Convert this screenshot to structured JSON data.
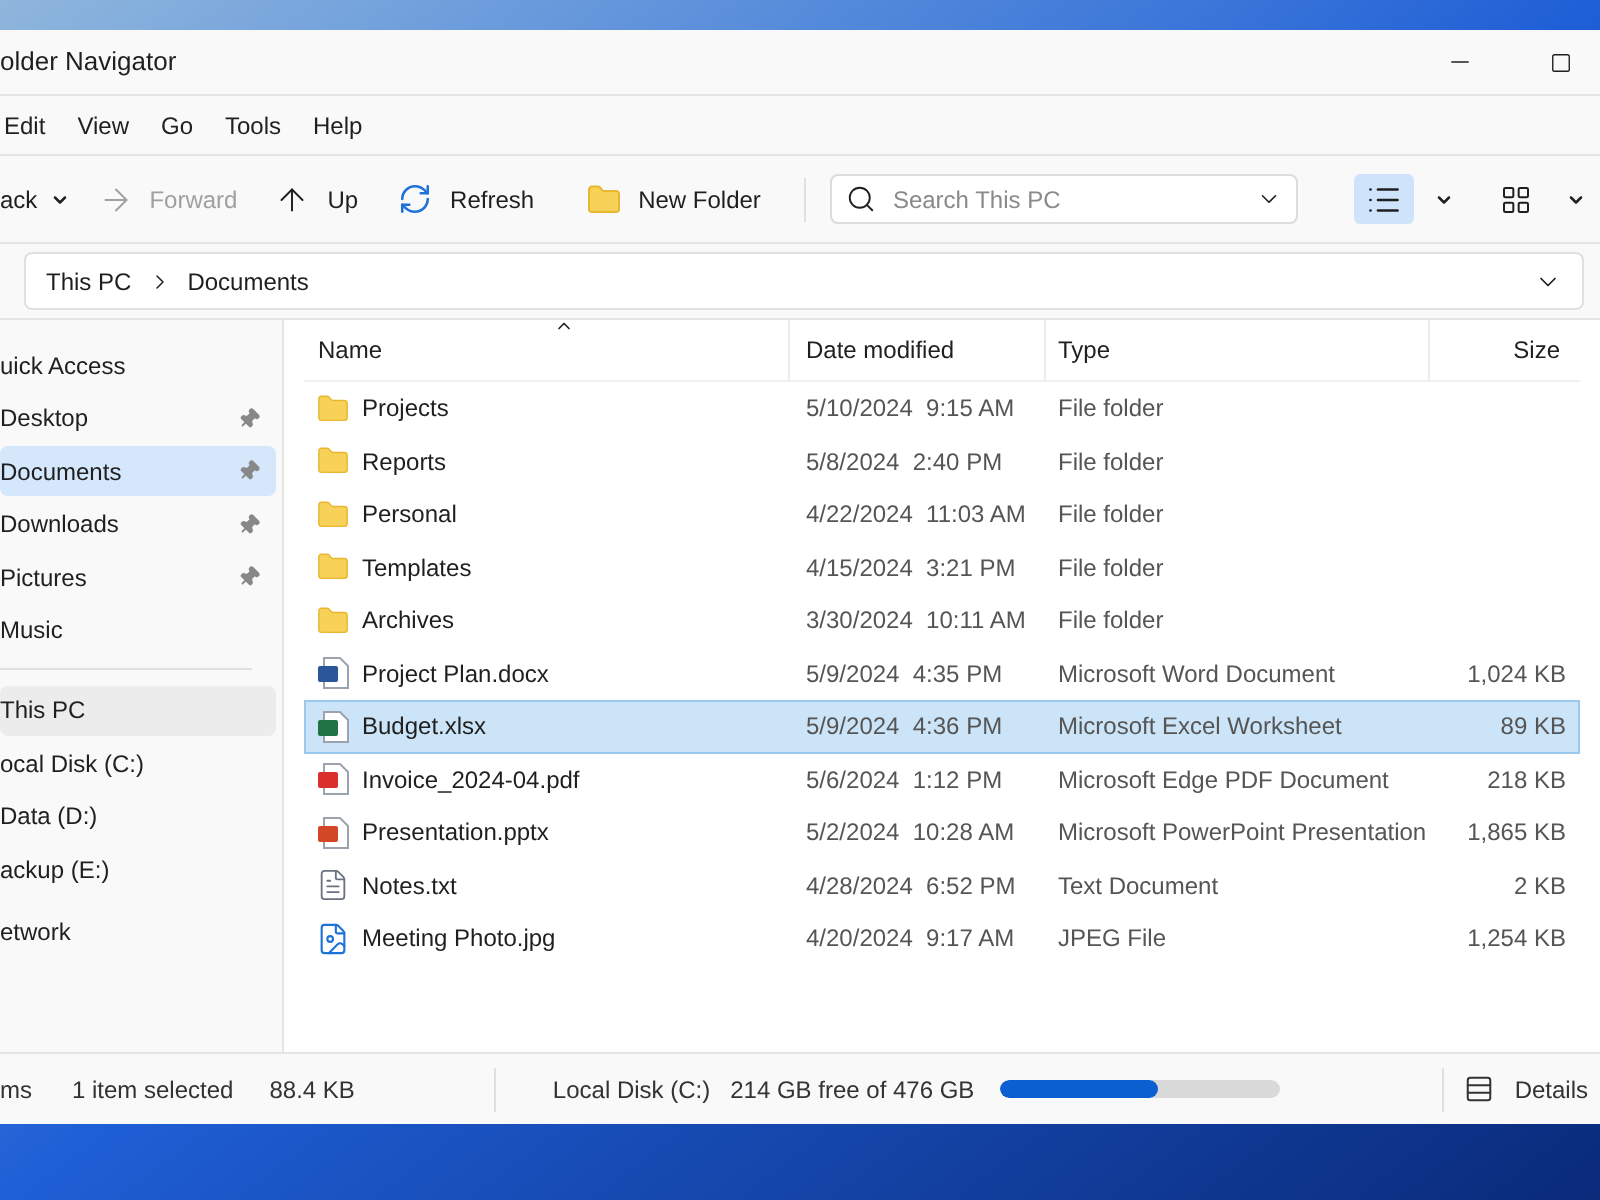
{
  "window": {
    "title": "older Navigator"
  },
  "menu": [
    "Edit",
    "View",
    "Go",
    "Tools",
    "Help"
  ],
  "toolbar": {
    "back": "ack",
    "forward": {
      "label": "Forward",
      "disabled": true
    },
    "up": "Up",
    "refresh": "Refresh",
    "new_folder": "New Folder",
    "search": {
      "placeholder": "Search This PC"
    },
    "views": [
      {
        "kind": "list",
        "selected": true
      },
      {
        "kind": "grid",
        "selected": false
      }
    ]
  },
  "address": [
    "This PC",
    "Documents"
  ],
  "sidebar": [
    {
      "label": "uick Access",
      "highlighted": false,
      "items": [
        {
          "label": "Desktop",
          "pinned": true,
          "selected": false
        },
        {
          "label": "Documents",
          "pinned": true,
          "selected": true
        },
        {
          "label": "Downloads",
          "pinned": true,
          "selected": false
        },
        {
          "label": "Pictures",
          "pinned": true,
          "selected": false
        },
        {
          "label": "Music",
          "pinned": false,
          "selected": false
        }
      ]
    },
    {
      "label": "This PC",
      "highlighted": true,
      "items": [
        {
          "label": "ocal Disk (C:)",
          "pinned": false,
          "selected": false
        },
        {
          "label": "Data (D:)",
          "pinned": false,
          "selected": false
        },
        {
          "label": "ackup (E:)",
          "pinned": false,
          "selected": false
        }
      ]
    },
    {
      "label": "etwork",
      "highlighted": false
    }
  ],
  "table": {
    "columns": [
      "Name",
      "Date modified",
      "Type",
      "Size"
    ],
    "rows": [
      {
        "kind": "folder",
        "name": "Projects",
        "date": "5/10/2024  9:15 AM",
        "type": "File folder",
        "selected": false
      },
      {
        "kind": "folder",
        "name": "Reports",
        "date": "5/8/2024  2:40 PM",
        "type": "File folder",
        "selected": false
      },
      {
        "kind": "folder",
        "name": "Personal",
        "date": "4/22/2024  11:03 AM",
        "type": "File folder",
        "selected": false
      },
      {
        "kind": "folder",
        "name": "Templates",
        "date": "4/15/2024  3:21 PM",
        "type": "File folder",
        "selected": false
      },
      {
        "kind": "folder",
        "name": "Archives",
        "date": "3/30/2024  10:11 AM",
        "type": "File folder",
        "selected": false
      },
      {
        "kind": "word",
        "name": "Project Plan.docx",
        "date": "5/9/2024  4:35 PM",
        "type": "Microsoft Word Document",
        "size": "1,024 KB",
        "selected": false
      },
      {
        "kind": "excel",
        "name": "Budget.xlsx",
        "date": "5/9/2024  4:36 PM",
        "type": "Microsoft Excel Worksheet",
        "size": "89 KB",
        "selected": true
      },
      {
        "kind": "pdf",
        "name": "Invoice_2024-04.pdf",
        "date": "5/6/2024  1:12 PM",
        "type": "Microsoft Edge PDF Document",
        "size": "218 KB",
        "selected": false
      },
      {
        "kind": "powerpoint",
        "name": "Presentation.pptx",
        "date": "5/2/2024  10:28 AM",
        "type": "Microsoft PowerPoint Presentation",
        "size": "1,865 KB",
        "selected": false
      },
      {
        "kind": "text",
        "name": "Notes.txt",
        "date": "4/28/2024  6:52 PM",
        "type": "Text Document",
        "size": "2 KB",
        "selected": false
      },
      {
        "kind": "image",
        "name": "Meeting Photo.jpg",
        "date": "4/20/2024  9:17 AM",
        "type": "JPEG File",
        "size": "1,254 KB",
        "selected": false
      }
    ]
  },
  "status_bar": {
    "items": "ms",
    "selection": "1 item selected",
    "selection_size": "88.4 KB",
    "disk": "Local Disk (C:)",
    "free": "214 GB free of 476 GB",
    "level": 0.56,
    "details": "Details"
  }
}
